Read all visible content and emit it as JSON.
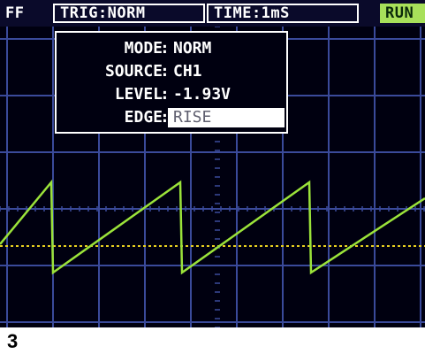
{
  "status_bar": {
    "left": "FF",
    "trigger": "TRIG:NORM",
    "time": "TIME:1mS",
    "run_state": "RUN"
  },
  "trigger_menu": {
    "rows": [
      {
        "label": "MODE",
        "value": "NORM"
      },
      {
        "label": "SOURCE",
        "value": "CH1"
      },
      {
        "label": "LEVEL",
        "value": "-1.93V"
      },
      {
        "label": "EDGE",
        "value": "RISE"
      }
    ],
    "selected_row": 3
  },
  "waveform": {
    "channel": "CH1",
    "shape": "sawtooth",
    "color": "#9be33a",
    "trigger_level_line_color": "#e8d020"
  },
  "colors": {
    "screen_bg": "#000010",
    "grid": "#3a4a9a",
    "run_badge": "#a8e05a"
  },
  "figure_label": "3"
}
